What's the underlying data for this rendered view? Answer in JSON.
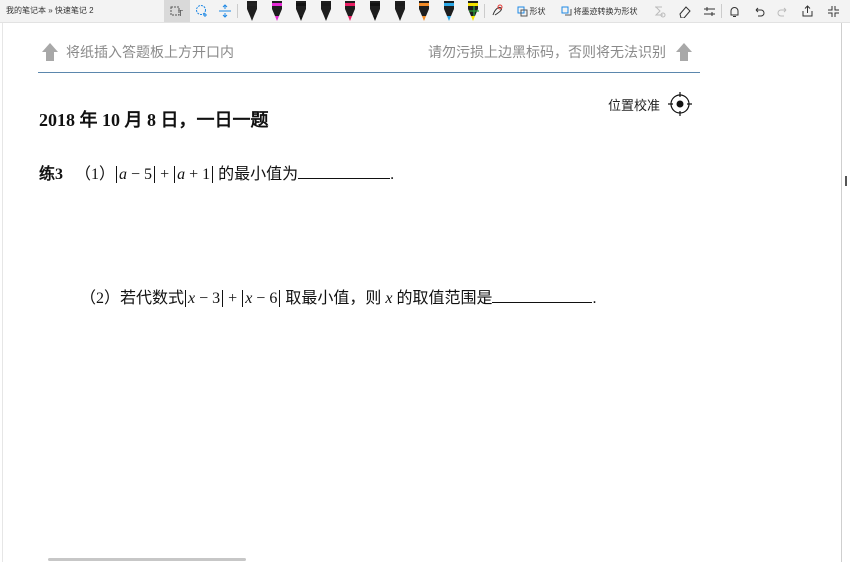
{
  "breadcrumb": "我的笔记本 » 快速笔记 2",
  "toolbar": {
    "shapes_label": "形状",
    "ink_to_shape_label": "将墨迹转换为形状",
    "pens": [
      {
        "color": "#222222"
      },
      {
        "color": "#e52bd4"
      },
      {
        "color": "#111111"
      },
      {
        "color": "#1a1a1a"
      },
      {
        "color": "#e91e63"
      },
      {
        "color": "#111111"
      },
      {
        "color": "#1a1a1a"
      },
      {
        "color": "#f28c28"
      },
      {
        "color": "#2aa7e6"
      },
      {
        "color": "#f5e100"
      }
    ]
  },
  "page": {
    "header_left": "将纸插入答题板上方开口内",
    "header_right": "请勿污损上边黑标码，否则将无法识别",
    "calibration": "位置校准",
    "date_title": "2018 年 10 月 8 日，一日一题",
    "q1": {
      "label": "练3",
      "part": "（1）",
      "a": "a",
      "minus5": " − 5",
      "plus": " + ",
      "plus1": " + 1",
      "text": "的最小值为",
      "end": "."
    },
    "q2": {
      "part": "（2）若代数式",
      "x": "x",
      "minus3": " − 3",
      "plus": " + ",
      "minus6": " − 6",
      "text1": "取最小值，则",
      "text2": "的取值范围是",
      "end": "."
    }
  }
}
